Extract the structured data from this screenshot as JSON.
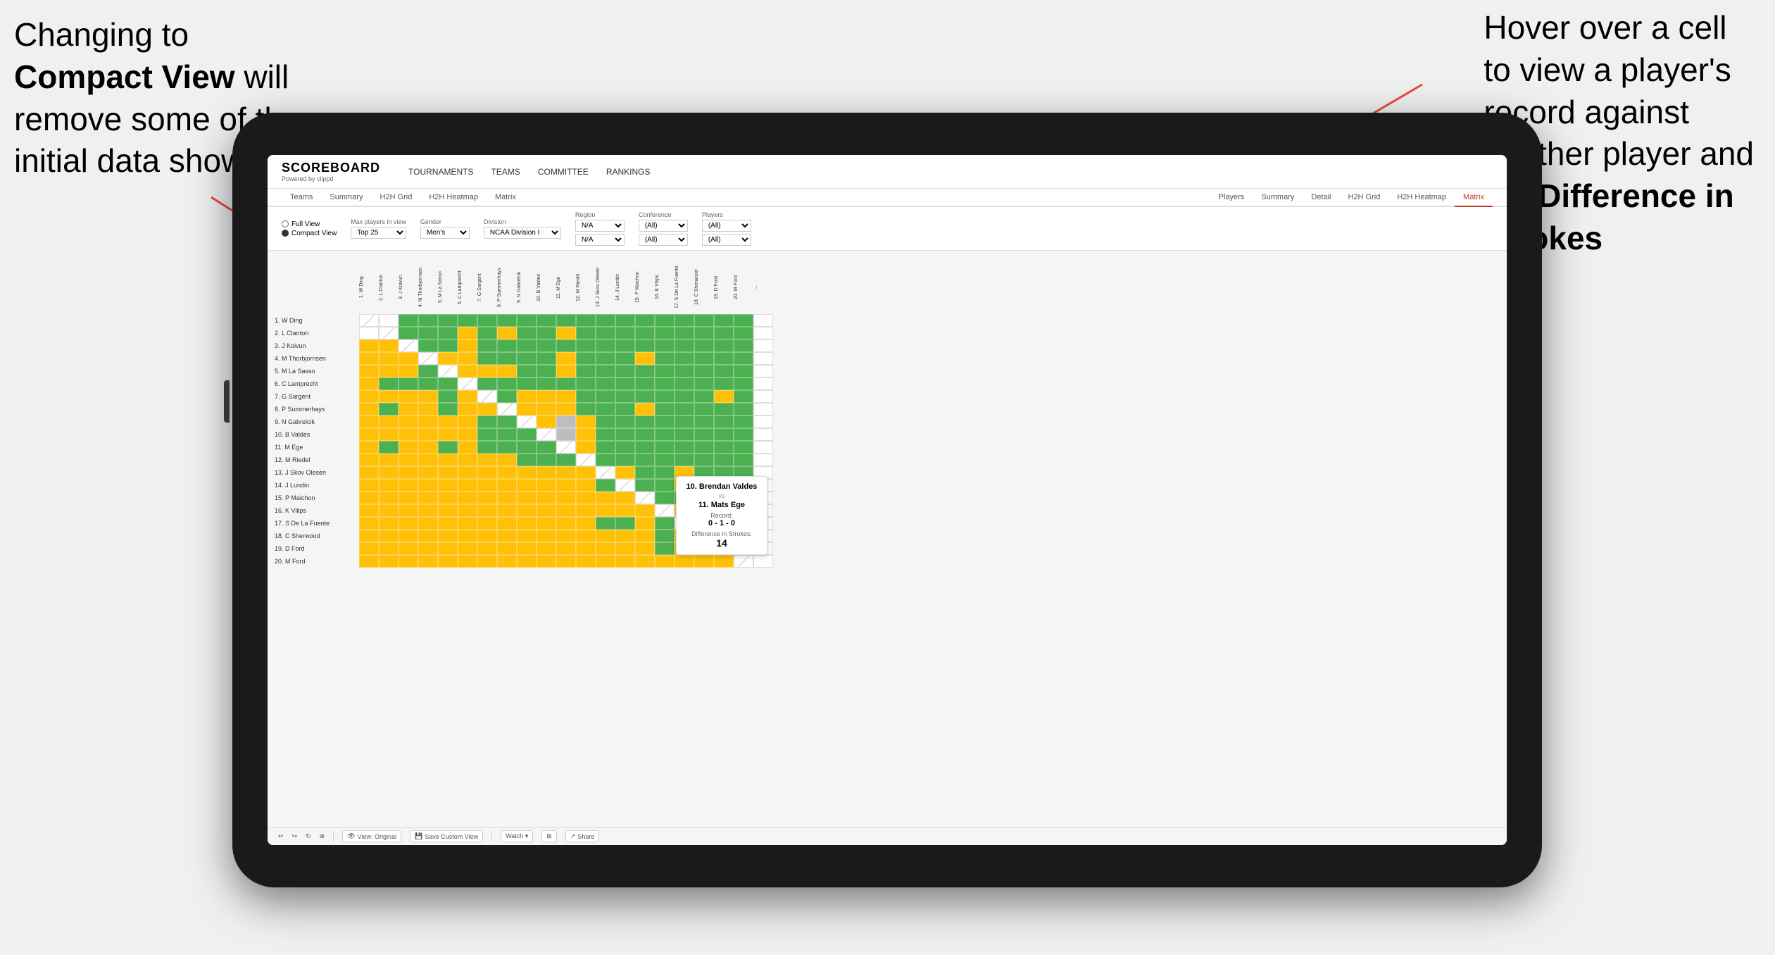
{
  "annotations": {
    "left": {
      "line1": "Changing to",
      "line2_bold": "Compact View",
      "line2_rest": " will",
      "line3": "remove some of the",
      "line4": "initial data shown"
    },
    "right": {
      "line1": "Hover over a cell",
      "line2": "to view a player's",
      "line3": "record against",
      "line4": "another player and",
      "line5_pre": "the ",
      "line5_bold": "Difference in",
      "line6_bold": "Strokes"
    }
  },
  "app": {
    "logo": "SCOREBOARD",
    "logo_sub": "Powered by clippd",
    "nav": [
      "TOURNAMENTS",
      "TEAMS",
      "COMMITTEE",
      "RANKINGS"
    ],
    "sub_tabs_left": [
      "Teams",
      "Summary",
      "H2H Grid",
      "H2H Heatmap",
      "Matrix"
    ],
    "sub_tabs_right": [
      "Players",
      "Summary",
      "Detail",
      "H2H Grid",
      "H2H Heatmap",
      "Matrix"
    ],
    "active_tab": "Matrix"
  },
  "controls": {
    "view_full": "Full View",
    "view_compact": "Compact View",
    "view_compact_selected": true,
    "max_players_label": "Max players in view",
    "max_players_value": "Top 25",
    "gender_label": "Gender",
    "gender_value": "Men's",
    "division_label": "Division",
    "division_value": "NCAA Division I",
    "region_label": "Region",
    "region_value": "N/A",
    "region_value2": "N/A",
    "conference_label": "Conference",
    "conference_value": "(All)",
    "conference_value2": "(All)",
    "players_label": "Players",
    "players_value": "(All)",
    "players_value2": "(All)"
  },
  "players": [
    "1. W Ding",
    "2. L Clanton",
    "3. J Koivun",
    "4. M Thorbjornsen",
    "5. M La Sasso",
    "6. C Lamprecht",
    "7. G Sargent",
    "8. P Summerhays",
    "9. N Gabrelcik",
    "10. B Valdes",
    "11. M Ege",
    "12. M Riedel",
    "13. J Skov Olesen",
    "14. J Lundin",
    "15. P Maichon",
    "16. K Vilips",
    "17. S De La Fuente",
    "18. C Sherwood",
    "19. D Ford",
    "20. M Ford"
  ],
  "col_headers": [
    "1. W Ding",
    "2. L Clanton",
    "3. J Koivun",
    "4. M Thorbjornsen",
    "5. M La Sasso",
    "6. C Lamprecht",
    "7. G Sargent",
    "8. P Summerhays",
    "9. N Gabrelcik",
    "10. B Valdes",
    "11. M Ege",
    "12. M Riedel",
    "13. J Skov Olesen",
    "14. J Lundin",
    "15. P Maichon",
    "16. K Vilips",
    "17. S De La Fuente",
    "18. C Sherwood",
    "19. D Ford",
    "20. M Ford",
    "..."
  ],
  "tooltip": {
    "player1": "10. Brendan Valdes",
    "vs": "vs",
    "player2": "11. Mats Ege",
    "record_label": "Record:",
    "record": "0 - 1 - 0",
    "diff_label": "Difference in Strokes:",
    "diff": "14"
  },
  "toolbar": {
    "undo": "↩",
    "redo": "↪",
    "view_original": "View: Original",
    "save_custom": "Save Custom View",
    "watch": "Watch ▾",
    "share": "Share"
  },
  "colors": {
    "green": "#4caf50",
    "yellow": "#ffc107",
    "gray": "#bdbdbd",
    "white": "#ffffff",
    "active_tab": "#c0392b"
  }
}
